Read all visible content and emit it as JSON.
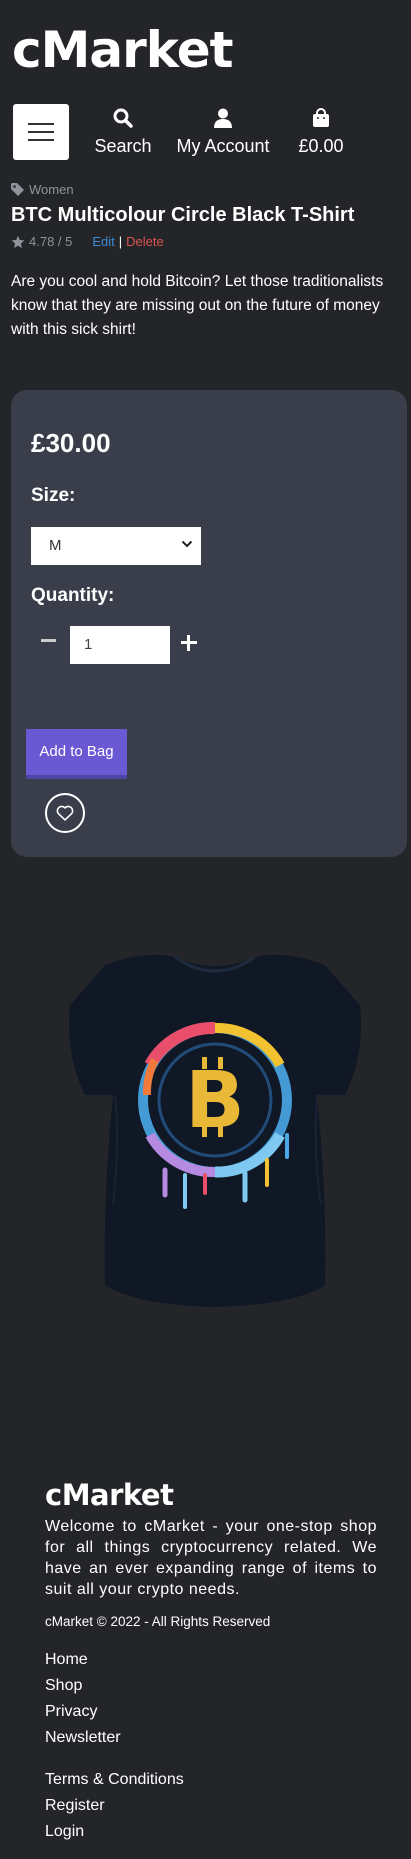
{
  "header": {
    "logo": "cMarket",
    "nav": {
      "search_label": "Search",
      "account_label": "My Account",
      "bag_total": "£0.00"
    }
  },
  "product": {
    "category": "Women",
    "title": "BTC Multicolour Circle Black T-Shirt",
    "rating": "4.78 / 5",
    "edit_label": "Edit",
    "separator": "|",
    "delete_label": "Delete",
    "description": "Are you cool and hold Bitcoin? Let those traditionalists know that they are missing out on the future of money with this sick shirt!"
  },
  "purchase": {
    "price": "£30.00",
    "size_label": "Size:",
    "size_value": "M",
    "quantity_label": "Quantity:",
    "quantity_value": "1",
    "add_to_bag_label": "Add to Bag"
  },
  "footer": {
    "logo": "cMarket",
    "description": "Welcome to cMarket - your one-stop shop for all things cryptocurrency related. We have an ever expanding range of items to suit all your crypto needs.",
    "copyright": "cMarket © 2022 - All Rights Reserved",
    "links_primary": [
      "Home",
      "Shop",
      "Privacy",
      "Newsletter"
    ],
    "links_secondary": [
      "Terms & Conditions",
      "Register",
      "Login"
    ]
  },
  "colors": {
    "background": "#242529",
    "card": "#3a3e4b",
    "accent": "#6b59d3",
    "edit_link": "#3d8bd6",
    "delete_link": "#d9534f"
  },
  "icons": [
    "menu-icon",
    "search-icon",
    "user-icon",
    "shopping-bag-icon",
    "tag-icon",
    "star-icon",
    "chevron-down-icon",
    "minus-icon",
    "plus-icon",
    "heart-icon"
  ]
}
